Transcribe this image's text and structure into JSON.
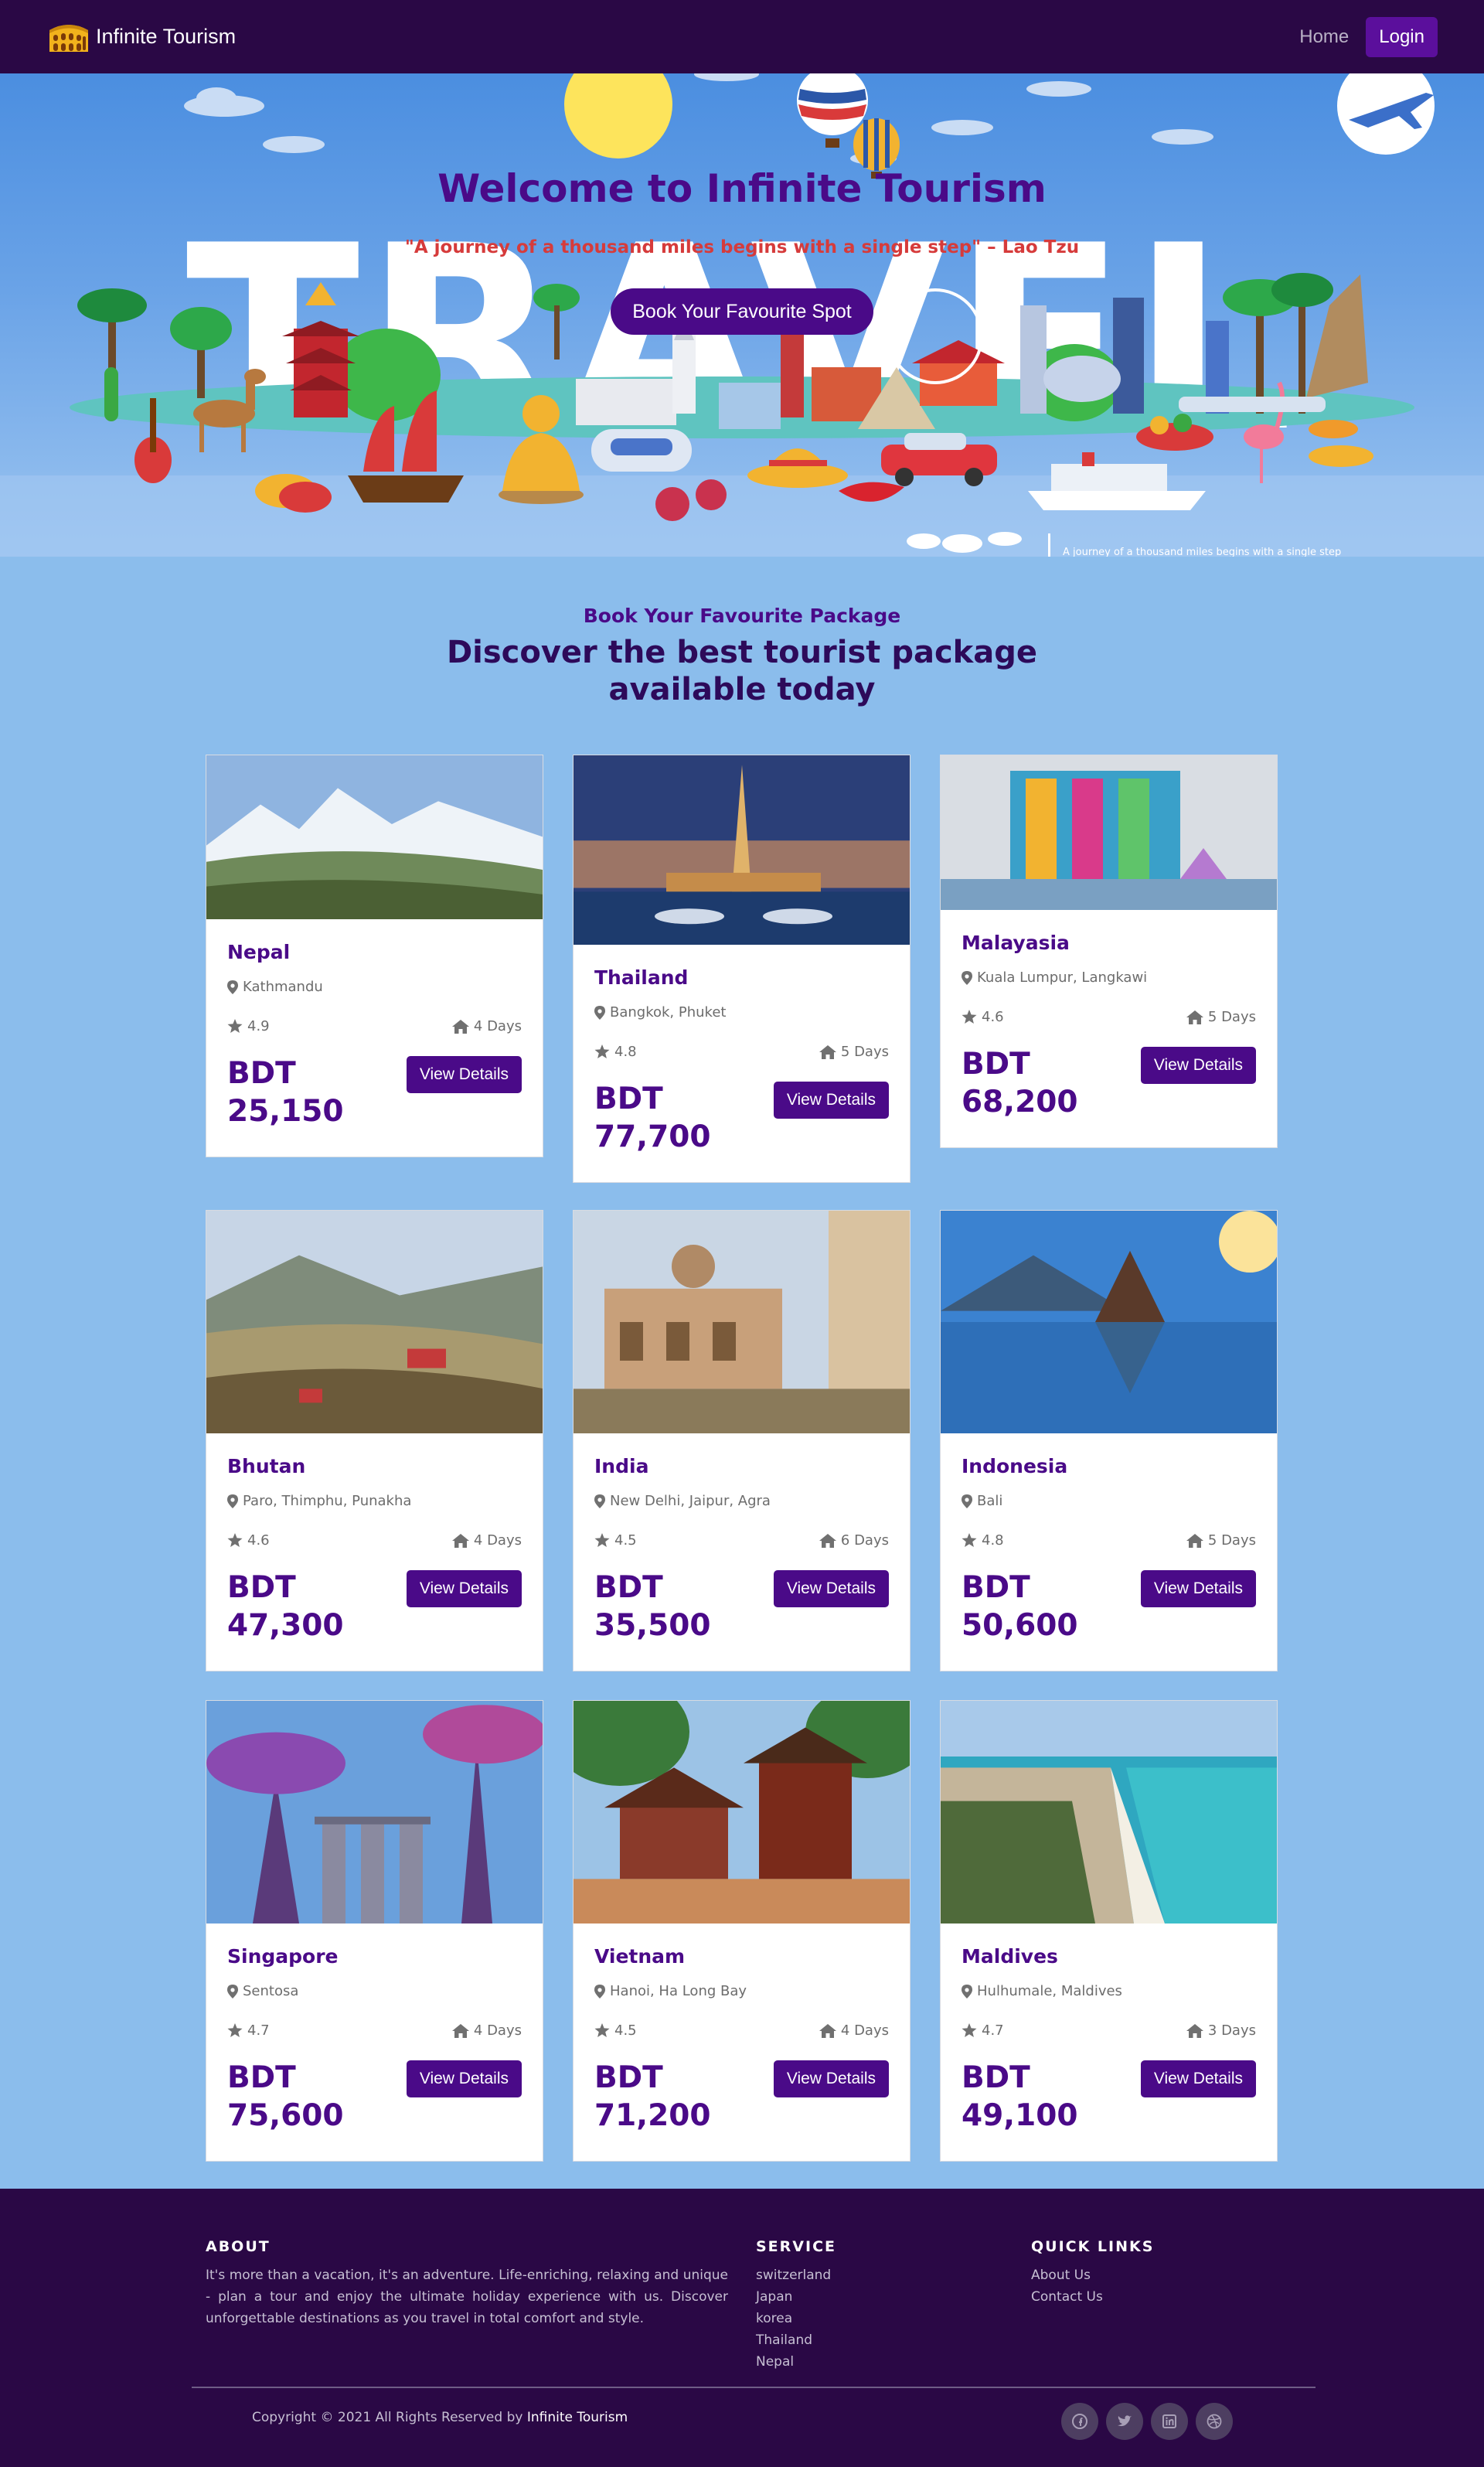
{
  "nav": {
    "brand": "Infinite Tourism",
    "home_label": "Home",
    "login_label": "Login"
  },
  "hero": {
    "backdrop_word": "TRAVEL",
    "title": "Welcome to Infinite Tourism",
    "quote": "\"A journey of a thousand miles begins with a single step\" – Lao Tzu",
    "cta_label": "Book Your Favourite Spot",
    "ticker_text": "A journey of a thousand miles begins with a single step"
  },
  "packages_section": {
    "subtitle": "Book Your Favourite Package",
    "title": "Discover the best tourist package available today"
  },
  "cards": [
    {
      "name": "Nepal",
      "location": "Kathmandu",
      "rating": "4.9",
      "duration": "4 Days",
      "currency": "BDT",
      "price": "25,150",
      "button": "View Details"
    },
    {
      "name": "Thailand",
      "location": "Bangkok, Phuket",
      "rating": "4.8",
      "duration": "5 Days",
      "currency": "BDT",
      "price": "77,700",
      "button": "View Details"
    },
    {
      "name": "Malayasia",
      "location": "Kuala Lumpur, Langkawi",
      "rating": "4.6",
      "duration": "5 Days",
      "currency": "BDT",
      "price": "68,200",
      "button": "View Details"
    },
    {
      "name": "Bhutan",
      "location": "Paro, Thimphu, Punakha",
      "rating": "4.6",
      "duration": "4 Days",
      "currency": "BDT",
      "price": "47,300",
      "button": "View Details"
    },
    {
      "name": "India",
      "location": "New Delhi, Jaipur, Agra",
      "rating": "4.5",
      "duration": "6 Days",
      "currency": "BDT",
      "price": "35,500",
      "button": "View Details"
    },
    {
      "name": "Indonesia",
      "location": "Bali",
      "rating": "4.8",
      "duration": "5 Days",
      "currency": "BDT",
      "price": "50,600",
      "button": "View Details"
    },
    {
      "name": "Singapore",
      "location": "Sentosa",
      "rating": "4.7",
      "duration": "4 Days",
      "currency": "BDT",
      "price": "75,600",
      "button": "View Details"
    },
    {
      "name": "Vietnam",
      "location": "Hanoi, Ha Long Bay",
      "rating": "4.5",
      "duration": "4 Days",
      "currency": "BDT",
      "price": "71,200",
      "button": "View Details"
    },
    {
      "name": "Maldives",
      "location": "Hulhumale, Maldives",
      "rating": "4.7",
      "duration": "3 Days",
      "currency": "BDT",
      "price": "49,100",
      "button": "View Details"
    }
  ],
  "footer": {
    "about_heading": "ABOUT",
    "about_text": "It's more than a vacation, it's an adventure. Life-enriching, relaxing and unique - plan a tour and enjoy the ultimate holiday experience with us. Discover unforgettable destinations as you travel in total comfort and style.",
    "service_heading": "SERVICE",
    "service_items": [
      "switzerland",
      "Japan",
      "korea",
      "Thailand",
      "Nepal"
    ],
    "links_heading": "QUICK LINKS",
    "link_items": [
      "About Us",
      "Contact Us"
    ],
    "copyright": "Copyright © 2021 All Rights Reserved by",
    "copyright_brand": "Infinite Tourism",
    "social_icons": [
      "facebook-icon",
      "twitter-icon",
      "linkedin-icon",
      "dribbble-icon"
    ]
  },
  "colors": {
    "nav_bg": "#2a0845",
    "accent": "#4a0a88",
    "page_bg": "#8bbdec",
    "quote_red": "#d63b3b"
  }
}
